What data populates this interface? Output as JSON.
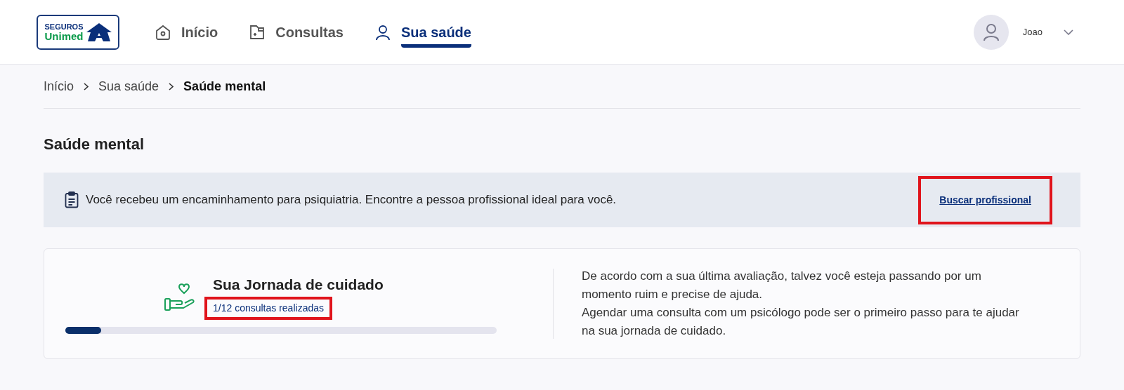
{
  "header": {
    "logo": {
      "line_1": "SEGUROS",
      "line_2": "Unimed"
    },
    "nav": [
      {
        "label": "Início",
        "selected": false
      },
      {
        "label": "Consultas",
        "selected": false
      },
      {
        "label": "Sua saúde",
        "selected": true
      }
    ],
    "user": {
      "name": "Joao"
    }
  },
  "breadcrumb": [
    {
      "label": "Início",
      "current": false
    },
    {
      "label": "Sua saúde",
      "current": false
    },
    {
      "label": "Saúde mental",
      "current": true
    }
  ],
  "title": "Saúde mental",
  "banner": {
    "text": "Você recebeu um encaminhamento para psiquiatria. Encontre a pessoa profissional ideal para você.",
    "link": {
      "label": "Buscar profissional",
      "highlighted": true
    }
  },
  "journey": {
    "title": "Sua Jornada de cuidado",
    "progress_text": "1/12 consultas realizadas",
    "progress_highlighted": true,
    "level": 0.083,
    "description": [
      "De acordo com a sua última avaliação, talvez você esteja passando por um momento ruim e precise de ajuda.",
      "Agendar uma consulta com um psicólogo pode ser o primeiro passo para te ajudar na sua jornada de cuidado."
    ]
  }
}
